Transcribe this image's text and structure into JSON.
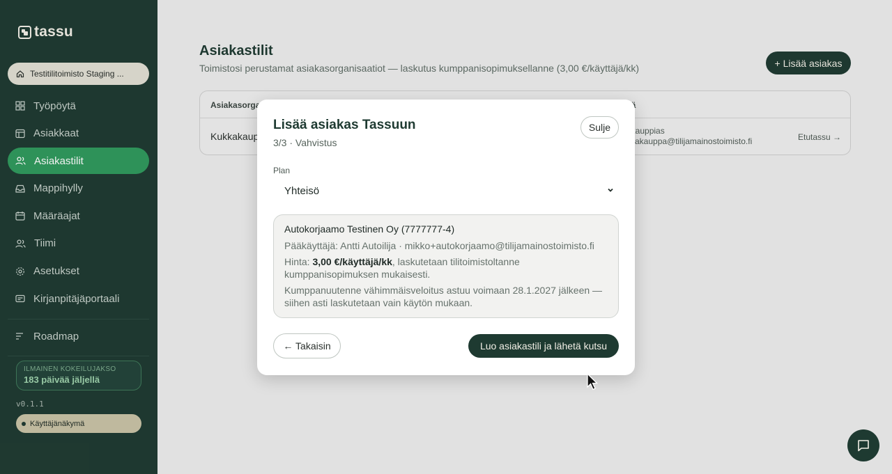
{
  "sidebar": {
    "logo": "tassu",
    "org": "Testitilitoimisto Staging ...",
    "items": [
      {
        "label": "Työpöytä",
        "icon": "grid-icon",
        "active": false
      },
      {
        "label": "Asiakkaat",
        "icon": "table-icon",
        "active": false
      },
      {
        "label": "Asiakastilit",
        "icon": "users-icon",
        "active": true
      },
      {
        "label": "Mappihylly",
        "icon": "inbox-icon",
        "active": false
      },
      {
        "label": "Määräajat",
        "icon": "calendar-icon",
        "active": false
      },
      {
        "label": "Tiimi",
        "icon": "team-icon",
        "active": false
      },
      {
        "label": "Asetukset",
        "icon": "gear-icon",
        "active": false
      },
      {
        "label": "Kirjanpitäjäportaali",
        "icon": "card-icon",
        "active": false
      }
    ],
    "roadmap": "Roadmap",
    "trial": {
      "label": "ILMAINEN KOKEILUJAKSO",
      "days": "183 päivää jäljellä"
    },
    "version": "v0.1.1",
    "user_view": "Käyttäjänäkymä"
  },
  "main": {
    "title": "Asiakastilit",
    "subtitle": "Toimistosi perustamat asiakasorganisaatiot — laskutus kumppanisopimuksellanne (3,00 €/käyttäjä/kk)",
    "add_button": "+ Lisää asiakas",
    "table": {
      "col1": "Asiakasorgani",
      "col2": "ijä",
      "row": {
        "name": "Kukkakaupp",
        "contact_name": "akauppias",
        "contact_email": "kkakauppa@tilijamainostoimisto.fi",
        "action": "Etutassu →"
      }
    }
  },
  "modal": {
    "title": "Lisää asiakas Tassuun",
    "step": "3/3 · Vahvistus",
    "close": "Sulje",
    "plan_label": "Plan",
    "plan_value": "Yhteisö",
    "summary": {
      "company": "Autokorjaamo Testinen Oy (7777777-4)",
      "admin": "Pääkäyttäjä: Antti Autoilija · mikko+autokorjaamo@tilijamainostoimisto.fi",
      "price_prefix": "Hinta: ",
      "price_value": "3,00 €/käyttäjä/kk",
      "price_suffix": ", laskutetaan tilitoimistoltanne kumppanisopimuksen mukaisesti.",
      "minimum": "Kumppanuutenne vähimmäisveloitus astuu voimaan 28.1.2027 jälkeen — siihen asti laskutetaan vain käytön mukaan."
    },
    "back": "← Takaisin",
    "create": "Luo asiakastili ja lähetä kutsu"
  }
}
